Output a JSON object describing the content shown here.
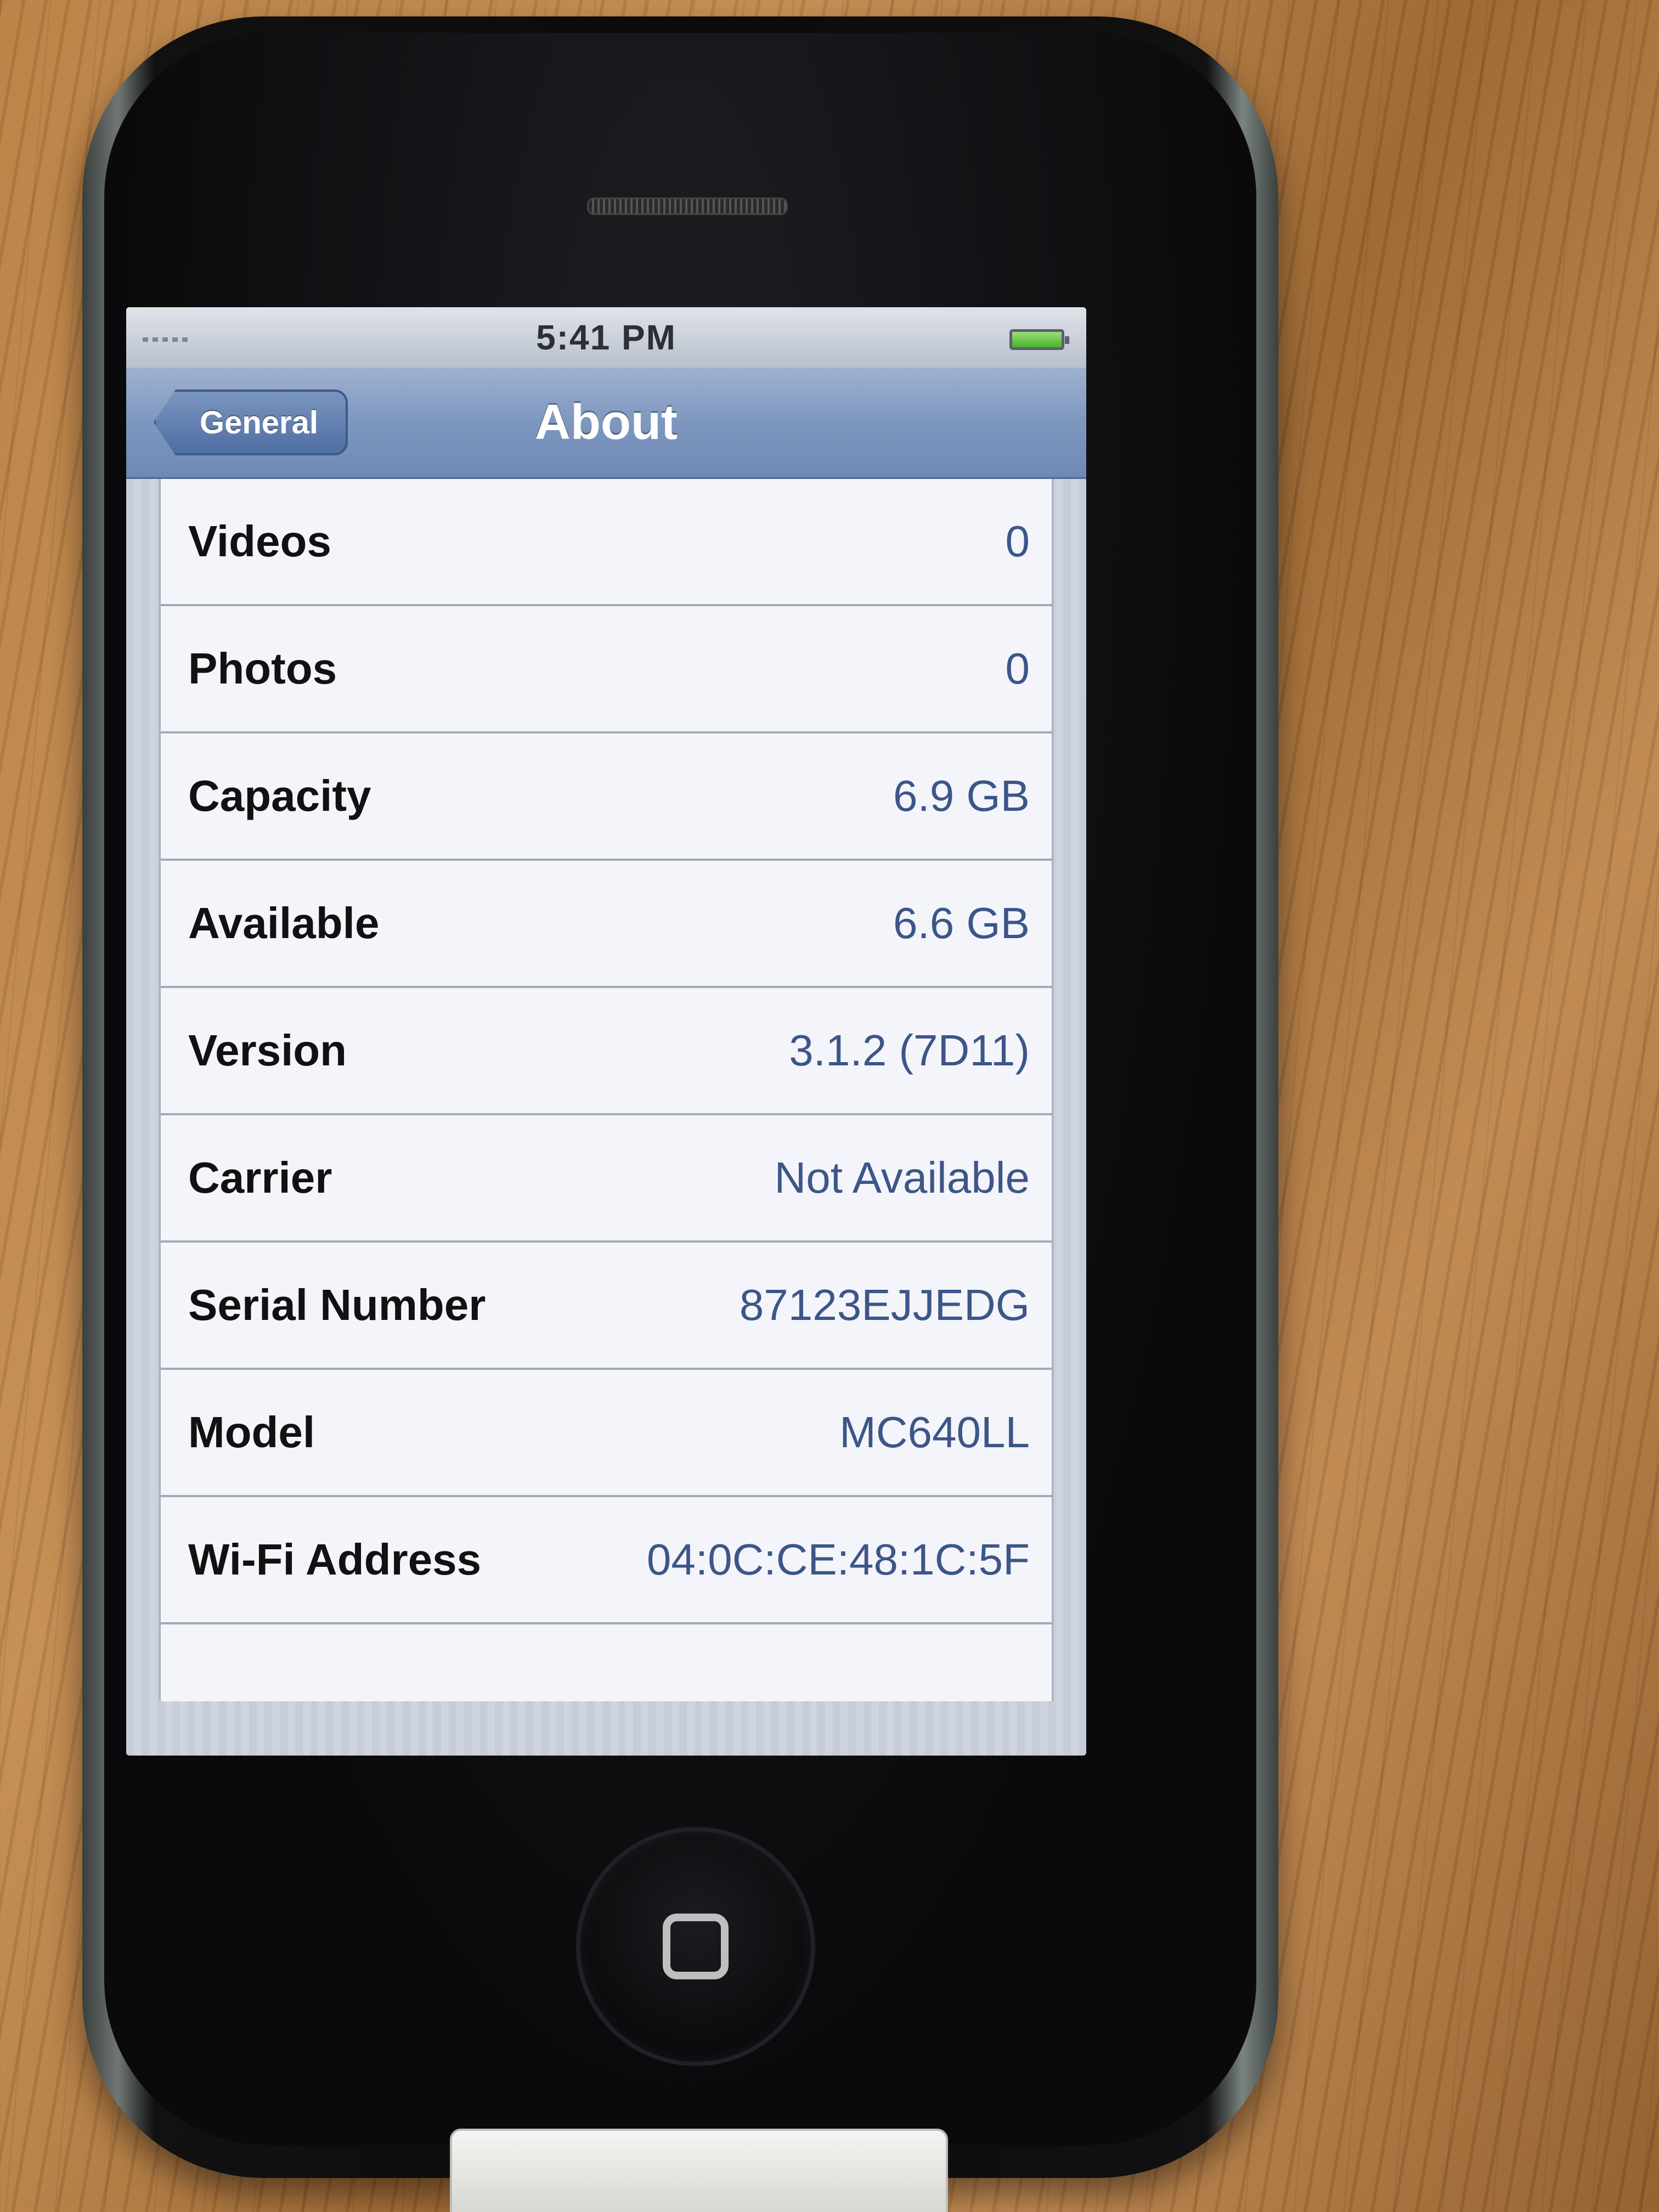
{
  "status_bar": {
    "time": "5:41 PM"
  },
  "nav": {
    "back_label": "General",
    "title": "About"
  },
  "rows": [
    {
      "label": "Videos",
      "value": "0"
    },
    {
      "label": "Photos",
      "value": "0"
    },
    {
      "label": "Capacity",
      "value": "6.9 GB"
    },
    {
      "label": "Available",
      "value": "6.6 GB"
    },
    {
      "label": "Version",
      "value": "3.1.2 (7D11)"
    },
    {
      "label": "Carrier",
      "value": "Not Available"
    },
    {
      "label": "Serial Number",
      "value": "87123EJJEDG"
    },
    {
      "label": "Model",
      "value": "MC640LL"
    },
    {
      "label": "Wi-Fi Address",
      "value": "04:0C:CE:48:1C:5F"
    }
  ],
  "icons": {
    "signal": "signal-icon",
    "battery": "battery-charging-icon",
    "home": "home-button-icon"
  },
  "colors": {
    "nav_bar": "#7e97bf",
    "value_text": "#3d5688",
    "battery_fill": "#4bb229"
  }
}
